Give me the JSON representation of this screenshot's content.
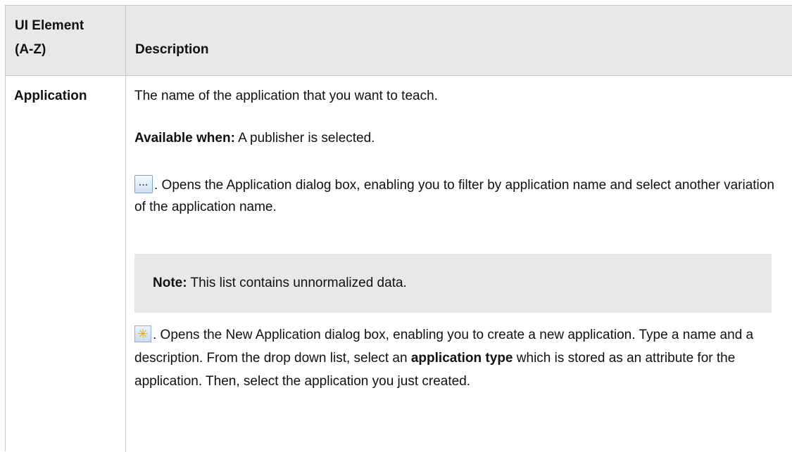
{
  "header": {
    "col1_line1": "UI Element",
    "col1_line2": "(A-Z)",
    "col2": "Description"
  },
  "row": {
    "name": "Application",
    "p1": "The name of the application that you want to teach.",
    "p2_label": "Available when:",
    "p2_text": " A publisher is selected.",
    "p3_text": ". Opens the Application dialog box, enabling you to filter by application name and select another variation of the application name.",
    "note_label": "Note:",
    "note_text": " This list contains unnormalized data.",
    "p4_text_a": ". Opens the New Application dialog box, enabling you to create a new application. Type a name and a description. From the drop down list, select an ",
    "p4_bold": "application type",
    "p4_text_b": " which is stored as an attribute for the application. Then, select the application you just created.",
    "browse_icon_glyph": "...",
    "new_icon_glyph": "✳"
  },
  "icons": {
    "browse": "browse-ellipsis-icon",
    "new": "new-item-star-icon"
  }
}
